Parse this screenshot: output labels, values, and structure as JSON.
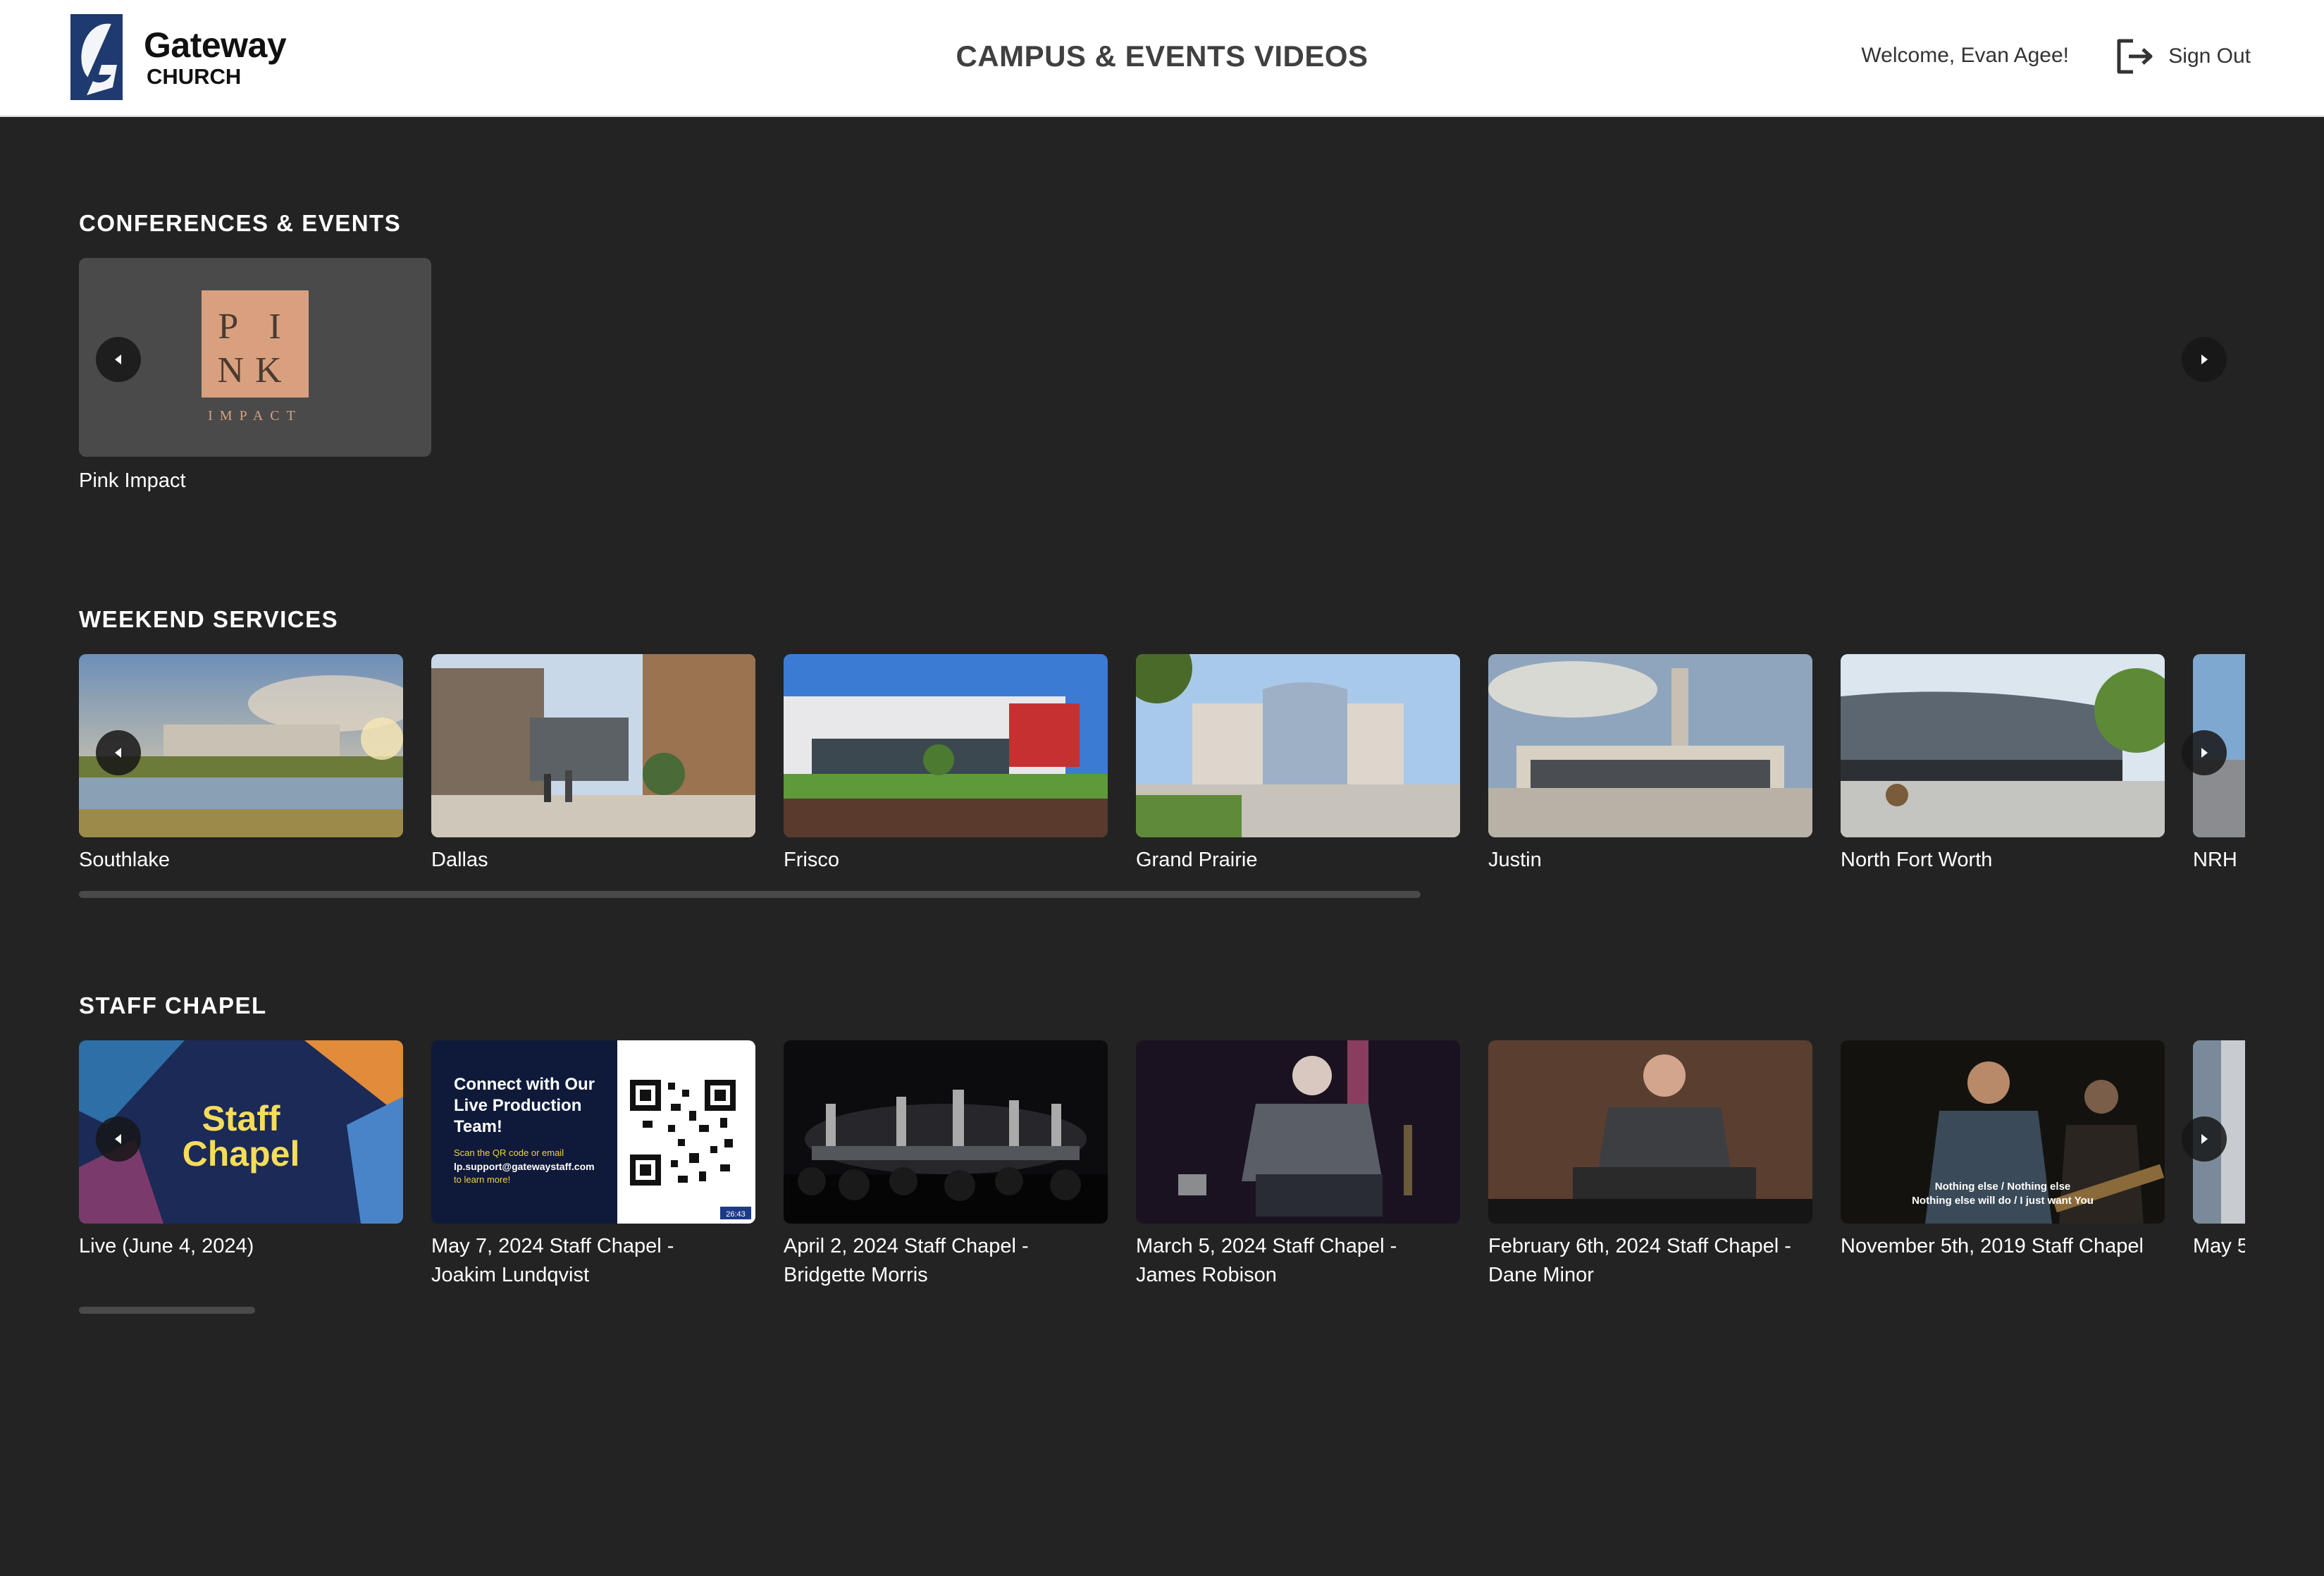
{
  "header": {
    "logo_title": "Gateway",
    "logo_sub": "CHURCH",
    "page_title": "CAMPUS & EVENTS VIDEOS",
    "welcome": "Welcome, Evan Agee!",
    "signout_label": "Sign Out",
    "signout_icon": "sign-out-icon"
  },
  "conferences": {
    "title": "CONFERENCES & EVENTS",
    "items": [
      {
        "label": "Pink Impact",
        "logo_lines": [
          "P I",
          "NK"
        ],
        "logo_sub": "IMPACT"
      }
    ]
  },
  "weekend": {
    "title": "WEEKEND SERVICES",
    "items": [
      {
        "label": "Southlake"
      },
      {
        "label": "Dallas"
      },
      {
        "label": "Frisco"
      },
      {
        "label": "Grand Prairie"
      },
      {
        "label": "Justin"
      },
      {
        "label": "North Fort Worth"
      },
      {
        "label": "NRH"
      }
    ]
  },
  "chapel": {
    "title": "STAFF CHAPEL",
    "items": [
      {
        "label": "Live (June 4, 2024)",
        "thumb_text": [
          "Staff",
          "Chapel"
        ]
      },
      {
        "label": "May 7, 2024 Staff Chapel - Joakim Lundqvist",
        "thumb_text": [
          "Connect with Our",
          "Live Production",
          "Team!",
          "Scan the QR code or email",
          "lp.support@gatewaystaff.com",
          "to learn more!",
          "26:43"
        ]
      },
      {
        "label": "April 2, 2024 Staff Chapel - Bridgette Morris"
      },
      {
        "label": "March 5, 2024 Staff Chapel - James Robison"
      },
      {
        "label": "February 6th, 2024 Staff Chapel - Dane Minor"
      },
      {
        "label": "November 5th, 2019 Staff Chapel",
        "thumb_text": [
          "Nothing else / Nothing else",
          "Nothing else will do / I just want You"
        ]
      },
      {
        "label": "May 5"
      }
    ]
  },
  "colors": {
    "background": "#232323",
    "header_bg": "#ffffff",
    "logo_blue": "#1e3a6e",
    "pink_tile": "#d9a07f",
    "chapel_yellow": "#f5dc5a"
  }
}
